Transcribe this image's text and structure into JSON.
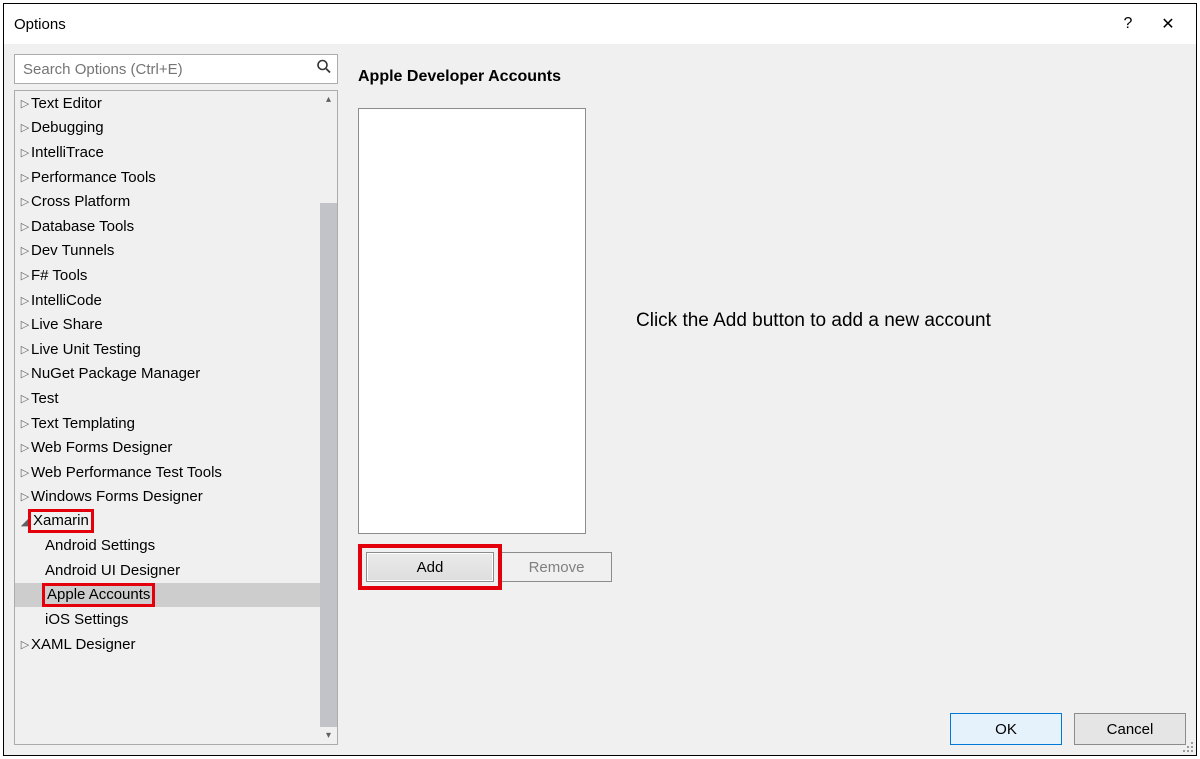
{
  "window": {
    "title": "Options",
    "help_icon": "?",
    "close_icon": "✕"
  },
  "search": {
    "placeholder": "Search Options (Ctrl+E)"
  },
  "tree": {
    "items": [
      {
        "label": "Text Editor",
        "expanded": false,
        "level": 0
      },
      {
        "label": "Debugging",
        "expanded": false,
        "level": 0
      },
      {
        "label": "IntelliTrace",
        "expanded": false,
        "level": 0
      },
      {
        "label": "Performance Tools",
        "expanded": false,
        "level": 0
      },
      {
        "label": "Cross Platform",
        "expanded": false,
        "level": 0
      },
      {
        "label": "Database Tools",
        "expanded": false,
        "level": 0
      },
      {
        "label": "Dev Tunnels",
        "expanded": false,
        "level": 0
      },
      {
        "label": "F# Tools",
        "expanded": false,
        "level": 0
      },
      {
        "label": "IntelliCode",
        "expanded": false,
        "level": 0
      },
      {
        "label": "Live Share",
        "expanded": false,
        "level": 0
      },
      {
        "label": "Live Unit Testing",
        "expanded": false,
        "level": 0
      },
      {
        "label": "NuGet Package Manager",
        "expanded": false,
        "level": 0
      },
      {
        "label": "Test",
        "expanded": false,
        "level": 0
      },
      {
        "label": "Text Templating",
        "expanded": false,
        "level": 0
      },
      {
        "label": "Web Forms Designer",
        "expanded": false,
        "level": 0
      },
      {
        "label": "Web Performance Test Tools",
        "expanded": false,
        "level": 0
      },
      {
        "label": "Windows Forms Designer",
        "expanded": false,
        "level": 0
      },
      {
        "label": "Xamarin",
        "expanded": true,
        "level": 0,
        "highlight": true
      },
      {
        "label": "Android Settings",
        "level": 1
      },
      {
        "label": "Android UI Designer",
        "level": 1
      },
      {
        "label": "Apple Accounts",
        "level": 1,
        "selected": true,
        "highlight": true
      },
      {
        "label": "iOS Settings",
        "level": 1
      },
      {
        "label": "XAML Designer",
        "expanded": false,
        "level": 0
      }
    ]
  },
  "panel": {
    "title": "Apple Developer Accounts",
    "hint": "Click the Add button to add a new account",
    "add_label": "Add",
    "remove_label": "Remove"
  },
  "footer": {
    "ok": "OK",
    "cancel": "Cancel"
  }
}
